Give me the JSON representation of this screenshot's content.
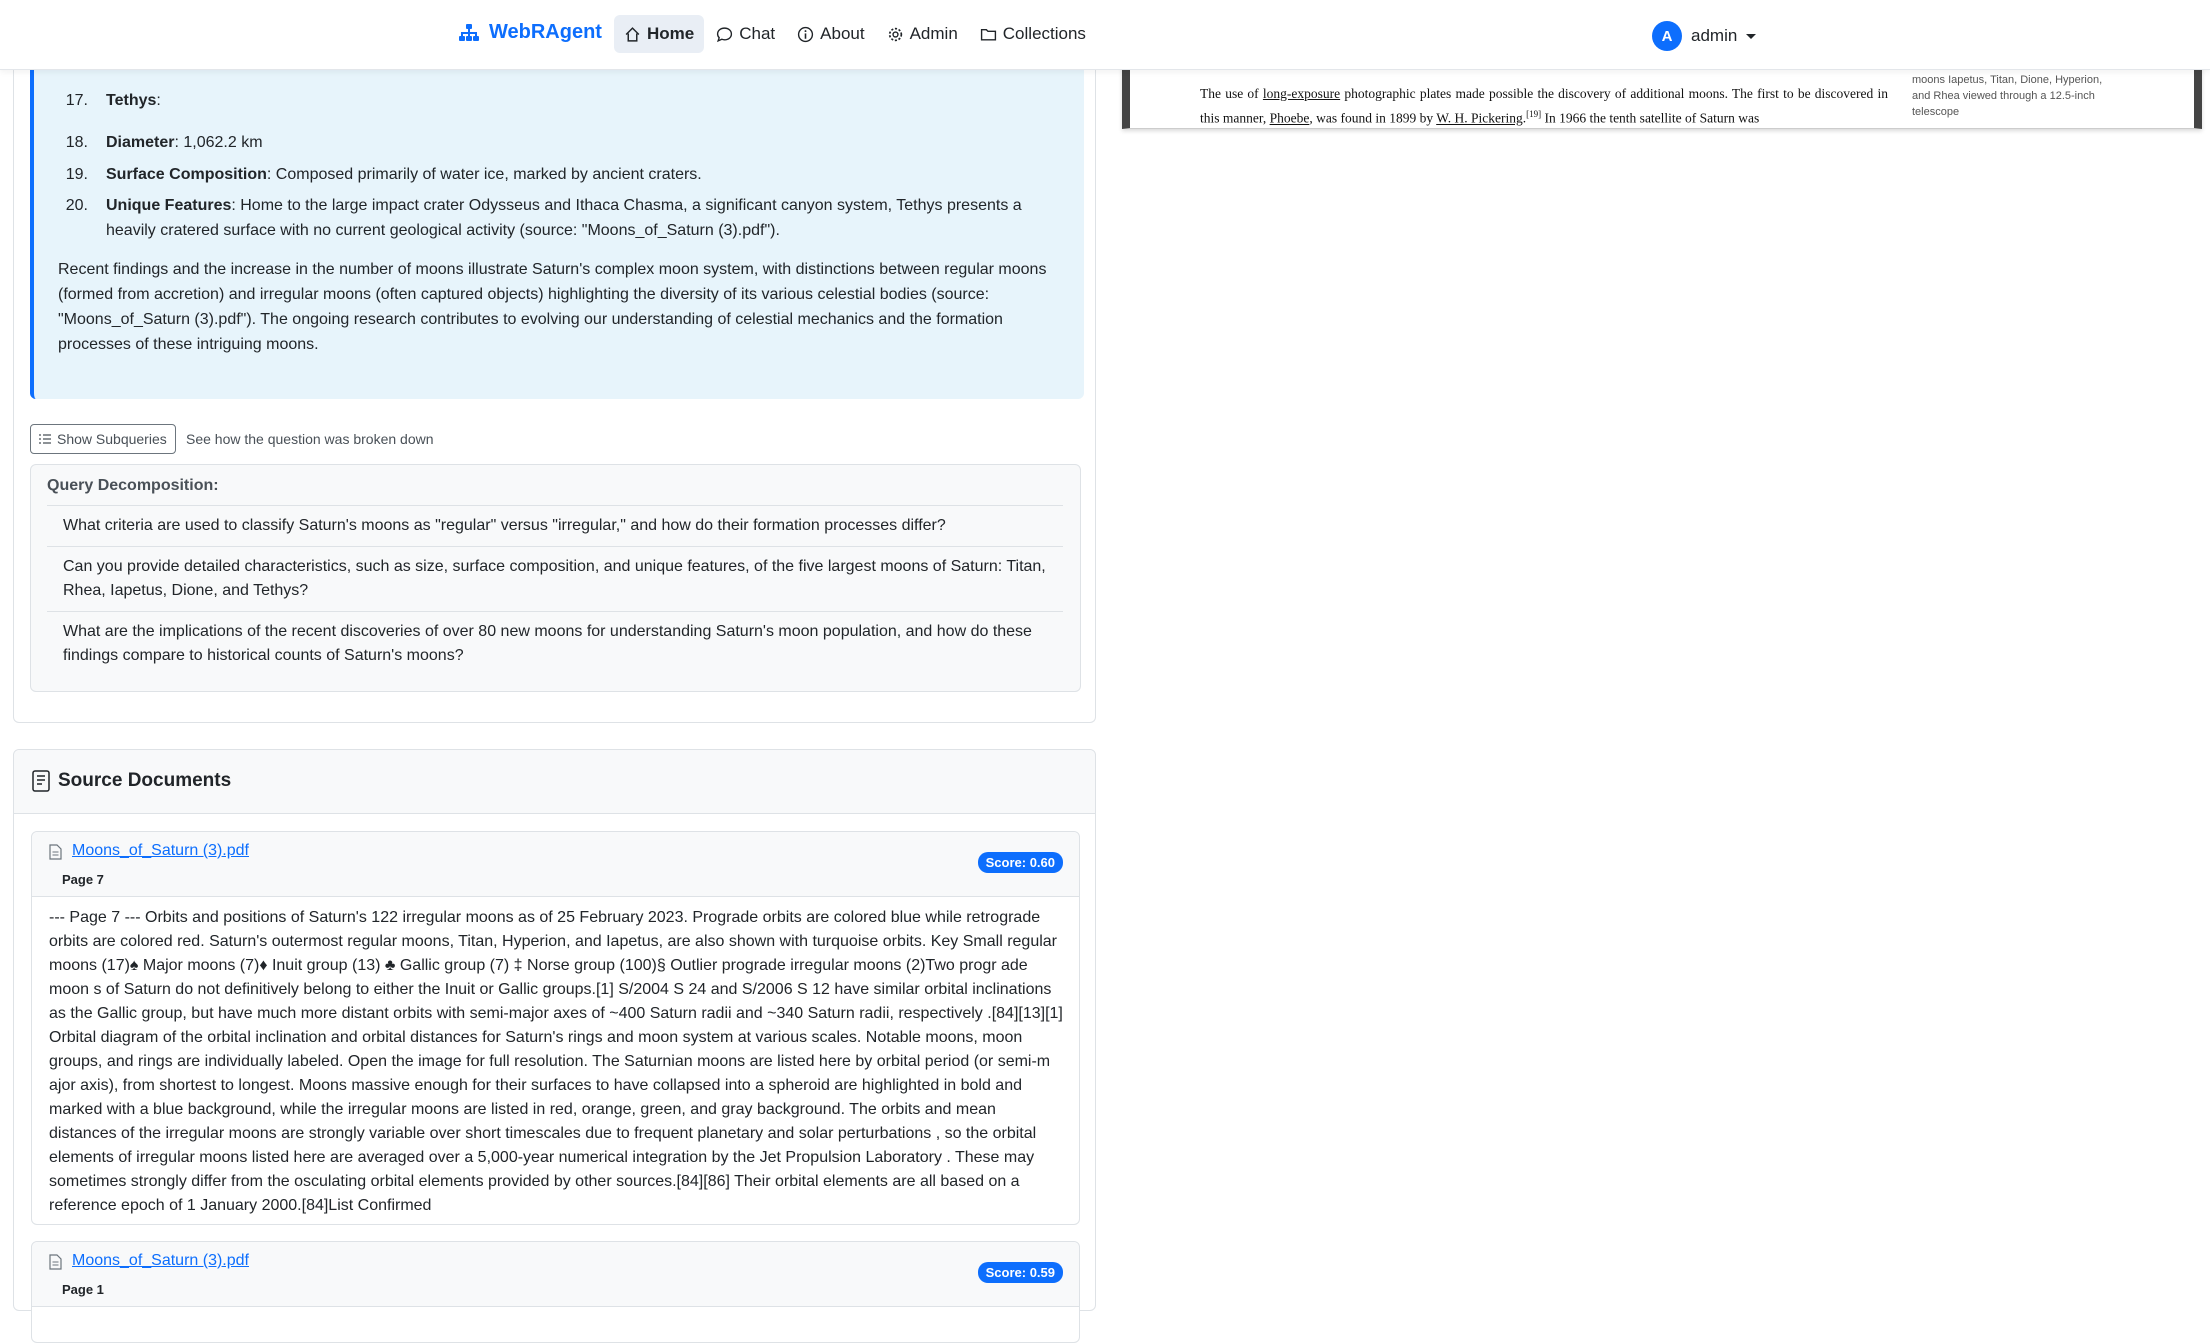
{
  "nav": {
    "brand": "WebRAgent",
    "items": [
      {
        "label": "Home",
        "icon": "home-icon"
      },
      {
        "label": "Chat",
        "icon": "chat-icon"
      },
      {
        "label": "About",
        "icon": "info-icon"
      },
      {
        "label": "Admin",
        "icon": "gear-icon"
      },
      {
        "label": "Collections",
        "icon": "folder-icon"
      }
    ],
    "user": {
      "initial": "A",
      "name": "admin"
    }
  },
  "answer": {
    "items": [
      {
        "num": "17.",
        "bold": "Tethys",
        "text": ":"
      },
      {
        "num": "18.",
        "bold": "Diameter",
        "text": ": 1,062.2 km"
      },
      {
        "num": "19.",
        "bold": "Surface Composition",
        "text": ": Composed primarily of water ice, marked by ancient craters."
      },
      {
        "num": "20.",
        "bold": "Unique Features",
        "text": ": Home to the large impact crater Odysseus and Ithaca Chasma, a significant canyon system, Tethys presents a heavily cratered surface with no current geological activity (source: \"Moons_of_Saturn (3).pdf\")."
      }
    ],
    "paragraph": "Recent findings and the increase in the number of moons illustrate Saturn's complex moon system, with distinctions between regular moons (formed from accretion) and irregular moons (often captured objects) highlighting the diversity of its various celestial bodies (source: \"Moons_of_Saturn (3).pdf\"). The ongoing research contributes to evolving our understanding of celestial mechanics and the formation processes of these intriguing moons."
  },
  "subqueries": {
    "button_label": "Show Subqueries",
    "hint": "See how the question was broken down",
    "title": "Query Decomposition:",
    "items": [
      "What criteria are used to classify Saturn's moons as \"regular\" versus \"irregular,\" and how do their formation processes differ?",
      "Can you provide detailed characteristics, such as size, surface composition, and unique features, of the five largest moons of Saturn: Titan, Rhea, Iapetus, Dione, and Tethys?",
      "What are the implications of the recent discoveries of over 80 new moons for understanding Saturn's moon population, and how do these findings compare to historical counts of Saturn's moons?"
    ]
  },
  "sources": {
    "title": "Source Documents",
    "docs": [
      {
        "name": "Moons_of_Saturn (3).pdf",
        "page": "Page 7",
        "score": "Score: 0.60",
        "text": "--- Page 7 --- Orbits and positions of Saturn's 122 irregular moons as of 25 February 2023. Prograde orbits are colored blue while retrograde orbits are colored red. Saturn's outermost regular moons, Titan, Hyperion, and Iapetus, are also shown with turquoise orbits. Key Small regular moons (17)♠ Major moons (7)♦ Inuit group (13) ♣ Gallic group (7) ‡ Norse group (100)§ Outlier prograde irregular moons (2)Two progr ade moon s of Saturn do not definitively belong to either the Inuit or Gallic groups.[1] S/2004 S 24 and S/2006 S 12 have similar orbital inclinations as the Gallic group, but have much more distant orbits with semi-major axes of ~400 Saturn radii and ~340 Saturn radii, respectively .[84][13][1] Orbital diagram of the orbital inclination and orbital distances for Saturn's rings and moon system at various scales. Notable moons, moon groups, and rings are individually labeled. Open the image for full resolution. The Saturnian moons are listed here by orbital period (or semi-m ajor axis), from shortest to longest. Moons massive enough for their surfaces to have collapsed into a spheroid are highlighted in bold and marked with a blue background, while the irregular moons are listed in red, orange, green, and gray background. The orbits and mean distances of the irregular moons are strongly variable over short timescales due to frequent planetary and solar perturbations , so the orbital elements of irregular moons listed here are averaged over a 5,000-year numerical integration by the Jet Propulsion Laboratory . These may sometimes strongly differ from the osculating orbital elements provided by other sources.[84][86] Their orbital elements are all based on a reference epoch of 1 January 2000.[84]List Confirmed"
      },
      {
        "name": "Moons_of_Saturn (3).pdf",
        "page": "Page 1",
        "score": "Score: 0.59"
      }
    ]
  },
  "pdf": {
    "line1_a": "The use of ",
    "line1_link": "long-exposure",
    "line1_b": " photographic plates made possible the discovery of additional moons. The first to be discovered in this manner, ",
    "line1_link2": "Phoebe",
    "line1_c": ", was found in 1899 by ",
    "line1_link3": "W. H. Pickering",
    "line1_sup": "[19]",
    "line1_d": " In 1966 the tenth satellite of Saturn was",
    "caption": "moons Iapetus, Titan, Dione, Hyperion, and Rhea viewed through a 12.5-inch telescope"
  },
  "colors": {
    "accent": "#0d6efd",
    "answer_bg": "#e7f4fb"
  }
}
